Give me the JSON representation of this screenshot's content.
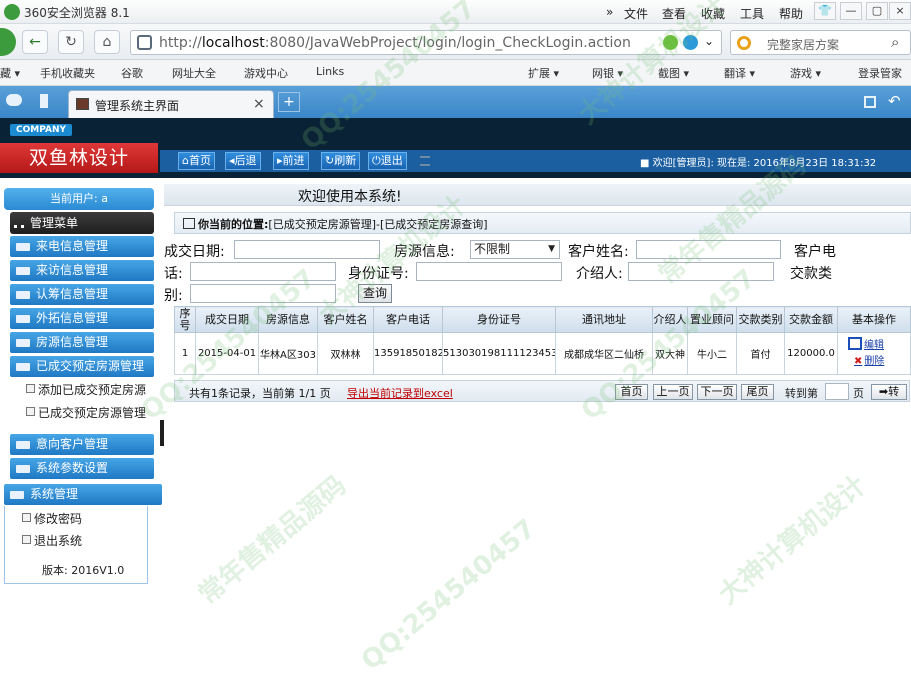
{
  "browser": {
    "title": "360安全浏览器 8.1",
    "menus": [
      "»",
      "文件",
      "查看",
      "收藏",
      "工具",
      "帮助"
    ],
    "url_prefix": "http://",
    "url_host": "localhost",
    "url_rest": ":8080/JavaWebProject/login/login_CheckLogin.action",
    "search_placeholder": "完整家居方案",
    "bookmarks_left": [
      "藏 ▾",
      "手机收藏夹",
      "谷歌",
      "网址大全",
      "游戏中心",
      "Links"
    ],
    "bookmarks_right": [
      "扩展 ▾",
      "网银 ▾",
      "截图 ▾",
      "翻译 ▾",
      "游戏 ▾",
      "登录管家"
    ],
    "tab_title": "管理系统主界面",
    "tab_close": "×",
    "new_tab": "+"
  },
  "app": {
    "company_badge": "COMPANY",
    "logo": "双鱼林设计",
    "nav": [
      "首页",
      "后退",
      "前进",
      "刷新",
      "退出"
    ],
    "welcome_text": "欢迎[管理员]:  现在是: 2016年8月23日 18:31:32"
  },
  "sidebar": {
    "current_user": "当前用户:",
    "menu_title": "管理菜单",
    "items": [
      "来电信息管理",
      "来访信息管理",
      "认筹信息管理",
      "外拓信息管理",
      "房源信息管理",
      "已成交预定房源管理"
    ],
    "sub_items": [
      "添加已成交预定房源",
      "已成交预定房源管理"
    ],
    "items2": [
      "意向客户管理",
      "系统参数设置"
    ],
    "sys_title": "系统管理",
    "sys_items": [
      "修改密码",
      "退出系统"
    ],
    "version": "版本: 2016V1.0"
  },
  "main": {
    "welcome": "欢迎使用本系统!",
    "position_label": "你当前的位置:",
    "position_path": "[已成交预定房源管理]-[已成交预定房源查询]",
    "form": {
      "deal_date_label": "成交日期:",
      "house_label": "房源信息:",
      "house_value": "不限制",
      "customer_name_label": "客户姓名:",
      "customer_phone_label_1": "客户电",
      "customer_phone_label_2": "话:",
      "id_label": "身份证号:",
      "introducer_label": "介绍人:",
      "payment_type_label_1": "交款类",
      "payment_type_label_2": "别:",
      "query_button": "查询"
    },
    "table": {
      "headers": [
        "序号",
        "成交日期",
        "房源信息",
        "客户姓名",
        "客户电话",
        "身份证号",
        "通讯地址",
        "介绍人",
        "置业顾问",
        "交款类别",
        "交款金额",
        "基本操作"
      ],
      "rows": [
        [
          "1",
          "2015-04-01",
          "华林A区303",
          "双林林",
          "13591850182",
          "513030198111123453",
          "成都成华区二仙桥",
          "双大神",
          "牛小二",
          "首付",
          "120000.0"
        ]
      ],
      "edit": "编辑",
      "delete": "删除"
    },
    "pager": {
      "summary": "共有1条记录，当前第 1/1 页",
      "export": "导出当前记录到excel",
      "first": "首页",
      "prev": "上一页",
      "next": "下一页",
      "last": "尾页",
      "goto": "转到第",
      "page": "页",
      "go": "➡转"
    }
  },
  "watermarks": [
    "QQ:254540457",
    "大神计算机设计",
    "常年售精品源码"
  ]
}
